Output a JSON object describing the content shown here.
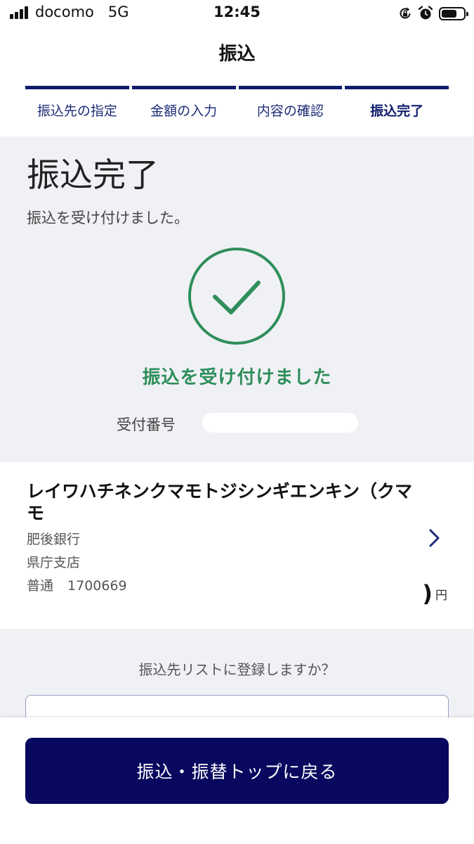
{
  "status_bar": {
    "carrier": "docomo",
    "network": "5G",
    "time": "12:45",
    "icons": [
      "signal-icon",
      "orientation-lock-icon",
      "alarm-icon",
      "battery-icon"
    ]
  },
  "header": {
    "title": "振込"
  },
  "steps": [
    {
      "label": "振込先の指定",
      "active": false
    },
    {
      "label": "金額の入力",
      "active": false
    },
    {
      "label": "内容の確認",
      "active": false
    },
    {
      "label": "振込完了",
      "active": true
    }
  ],
  "complete": {
    "heading": "振込完了",
    "message": "振込を受け付けました。",
    "icon": "check-circle-icon",
    "green_message": "振込を受け付けました",
    "receipt_label": "受付番号"
  },
  "payee": {
    "name": "レイワハチネンクマモトジシンギエンキン（クマモ",
    "bank": "肥後銀行",
    "branch": "県庁支店",
    "account_type": "普通",
    "account_number": "1700669",
    "amount_tail": ")",
    "amount_unit": "円"
  },
  "register": {
    "question": "振込先リストに登録しますか？"
  },
  "bottom": {
    "back_button_label": "振込・振替トップに戻る"
  },
  "colors": {
    "accent": "#0f1d6c",
    "button": "#08085f",
    "success": "#2f8e5a",
    "section_bg": "#f0f1f5"
  }
}
